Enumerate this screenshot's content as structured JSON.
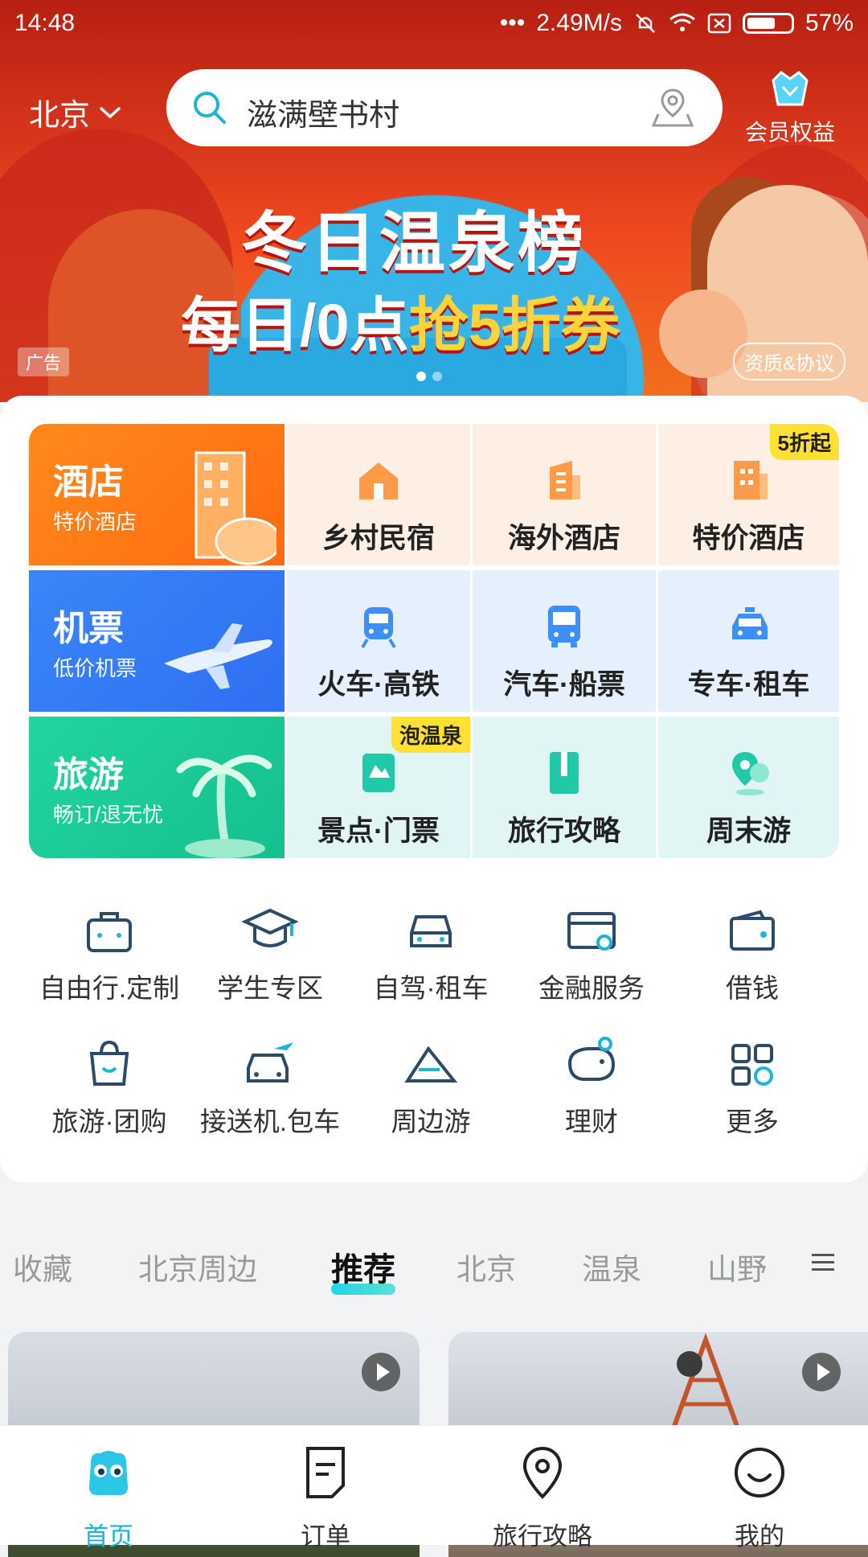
{
  "status_bar": {
    "time": "14:48",
    "speed": "2.49M/s",
    "battery": "57%"
  },
  "header": {
    "city": "北京",
    "search_placeholder": "滋满壁书村",
    "member_label": "会员权益"
  },
  "banner": {
    "headline": "冬日温泉榜",
    "subline_prefix": "每日/0点",
    "subline_highlight": "抢5折券",
    "ad_tag": "广告",
    "protocol_label": "资质&协议"
  },
  "main_grid": {
    "hotel": {
      "title": "酒店",
      "subtitle": "特价酒店"
    },
    "flight": {
      "title": "机票",
      "subtitle": "低价机票"
    },
    "travel": {
      "title": "旅游",
      "subtitle": "畅订/退无忧"
    },
    "cells": [
      {
        "label": "乡村民宿",
        "icon": "house-icon"
      },
      {
        "label": "海外酒店",
        "icon": "building-icon"
      },
      {
        "label": "特价酒店",
        "icon": "hotel-icon",
        "badge": "5折起"
      },
      {
        "label": "火车·高铁",
        "icon": "train-icon"
      },
      {
        "label": "汽车·船票",
        "icon": "bus-icon"
      },
      {
        "label": "专车·租车",
        "icon": "car-icon"
      },
      {
        "label": "景点·门票",
        "icon": "ticket-icon",
        "badge": "泡温泉"
      },
      {
        "label": "旅行攻略",
        "icon": "guidebook-icon"
      },
      {
        "label": "周末游",
        "icon": "location-pin-icon"
      }
    ]
  },
  "services": [
    {
      "label": "自由行.定制",
      "icon": "suitcase-icon"
    },
    {
      "label": "学生专区",
      "icon": "graduation-cap-icon"
    },
    {
      "label": "自驾·租车",
      "icon": "car-icon"
    },
    {
      "label": "金融服务",
      "icon": "card-icon"
    },
    {
      "label": "借钱",
      "icon": "wallet-icon"
    },
    {
      "label": "旅游·团购",
      "icon": "shopping-bag-icon"
    },
    {
      "label": "接送机.包车",
      "icon": "airport-car-icon"
    },
    {
      "label": "周边游",
      "icon": "mountain-icon"
    },
    {
      "label": "理财",
      "icon": "piggy-bank-icon"
    },
    {
      "label": "更多",
      "icon": "grid-icon"
    }
  ],
  "tabs": [
    "收藏",
    "北京周边",
    "推荐",
    "北京",
    "温泉",
    "山野"
  ],
  "active_tab": "推荐",
  "bottom_nav": [
    {
      "label": "首页",
      "icon": "home-mascot-icon",
      "active": true
    },
    {
      "label": "订单",
      "icon": "order-icon"
    },
    {
      "label": "旅行攻略",
      "icon": "location-pin-icon"
    },
    {
      "label": "我的",
      "icon": "smile-icon"
    }
  ],
  "colors": {
    "accent": "#18b5d6",
    "hotel_orange": "#ff7a12",
    "flight_blue": "#2f7cf6",
    "travel_green": "#19c99a",
    "badge_yellow": "#ffe033"
  }
}
